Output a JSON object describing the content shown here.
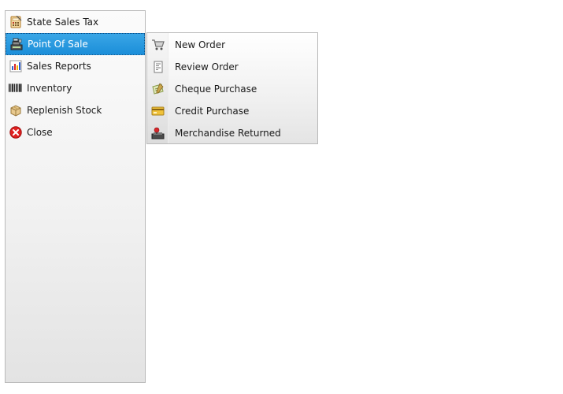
{
  "main_menu": {
    "items": [
      {
        "label": "State Sales Tax",
        "icon": "calculator-icon"
      },
      {
        "label": "Point Of Sale",
        "icon": "cash-register-icon",
        "selected": true
      },
      {
        "label": "Sales Reports",
        "icon": "chart-report-icon"
      },
      {
        "label": "Inventory",
        "icon": "barcode-icon"
      },
      {
        "label": "Replenish Stock",
        "icon": "box-icon"
      },
      {
        "label": "Close",
        "icon": "close-icon"
      }
    ]
  },
  "sub_menu": {
    "items": [
      {
        "label": "New Order",
        "icon": "shopping-cart-icon"
      },
      {
        "label": "Review Order",
        "icon": "receipt-icon"
      },
      {
        "label": "Cheque Purchase",
        "icon": "cheque-icon"
      },
      {
        "label": "Credit Purchase",
        "icon": "credit-card-icon"
      },
      {
        "label": "Merchandise Returned",
        "icon": "returned-merchandise-icon"
      }
    ]
  },
  "colors": {
    "selected_bg": "#1b8ed9",
    "selected_text": "#ffffff",
    "close_red": "#e02020"
  }
}
